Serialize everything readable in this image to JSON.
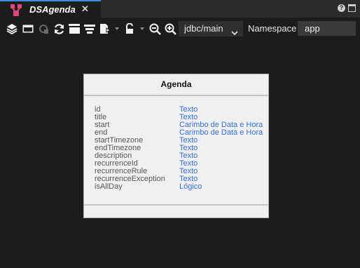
{
  "tab": {
    "title": "DSAgenda",
    "close_symbol": "✕",
    "icon": "datasource-icon"
  },
  "window_controls": {
    "help_symbol": "?",
    "icons": [
      "help-icon",
      "window-restore-icon"
    ]
  },
  "toolbar": {
    "icons": [
      "layers-icon",
      "window-icon",
      "sync-disabled-icon",
      "refresh-icon",
      "stack-icon",
      "align-icon",
      "export-icon",
      "lock-icon",
      "zoom-out-icon",
      "zoom-in-icon"
    ],
    "connection": {
      "selected": "jdbc/main"
    },
    "namespace_label": "Namespace",
    "namespace_value": "app"
  },
  "entity": {
    "title": "Agenda",
    "fields": [
      {
        "name": "id",
        "type": "Texto"
      },
      {
        "name": "title",
        "type": "Texto"
      },
      {
        "name": "start",
        "type": "Carimbo de Data e Hora"
      },
      {
        "name": "end",
        "type": "Carimbo de Data e Hora"
      },
      {
        "name": "startTimezone",
        "type": "Texto"
      },
      {
        "name": "endTimezone",
        "type": "Texto"
      },
      {
        "name": "description",
        "type": "Texto"
      },
      {
        "name": "recurrenceId",
        "type": "Texto"
      },
      {
        "name": "recurrenceRule",
        "type": "Texto"
      },
      {
        "name": "recurrenceException",
        "type": "Texto"
      },
      {
        "name": "isAllDay",
        "type": "Lógico"
      }
    ]
  },
  "colors": {
    "accent": "#3a8ee6",
    "link": "#2f6fe0",
    "background": "#1c1c1c",
    "icon_pink": "#e0457b"
  }
}
